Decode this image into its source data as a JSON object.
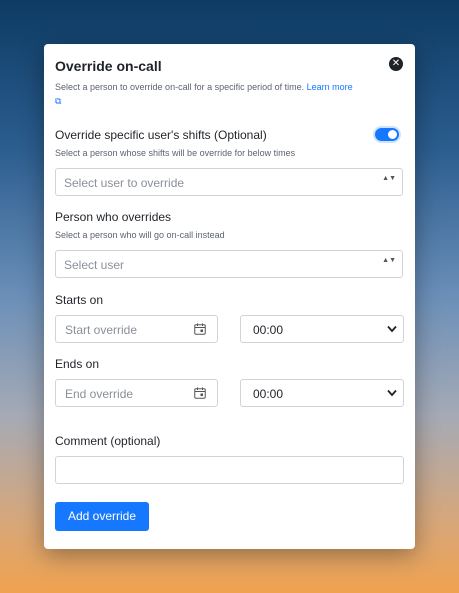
{
  "modal": {
    "title": "Override on-call",
    "description": "Select a person to override on-call for a specific period of time.",
    "learn_more": "Learn more",
    "close_label": "✕"
  },
  "override_shifts": {
    "label": "Override specific user's shifts (Optional)",
    "description": "Select a person whose shifts will be override for below times",
    "toggle_on": true,
    "select_placeholder": "Select user to override"
  },
  "overrider": {
    "label": "Person who overrides",
    "description": "Select a person who will go on-call instead",
    "select_placeholder": "Select user"
  },
  "starts_on": {
    "label": "Starts on",
    "date_placeholder": "Start override",
    "time_value": "00:00"
  },
  "ends_on": {
    "label": "Ends on",
    "date_placeholder": "End override",
    "time_value": "00:00"
  },
  "comment": {
    "label": "Comment (optional)",
    "value": ""
  },
  "submit": {
    "label": "Add override"
  },
  "colors": {
    "accent": "#1677ff",
    "text": "#1f2328",
    "muted": "#5c6370",
    "placeholder": "#8a9099",
    "border": "#d0d4da"
  }
}
